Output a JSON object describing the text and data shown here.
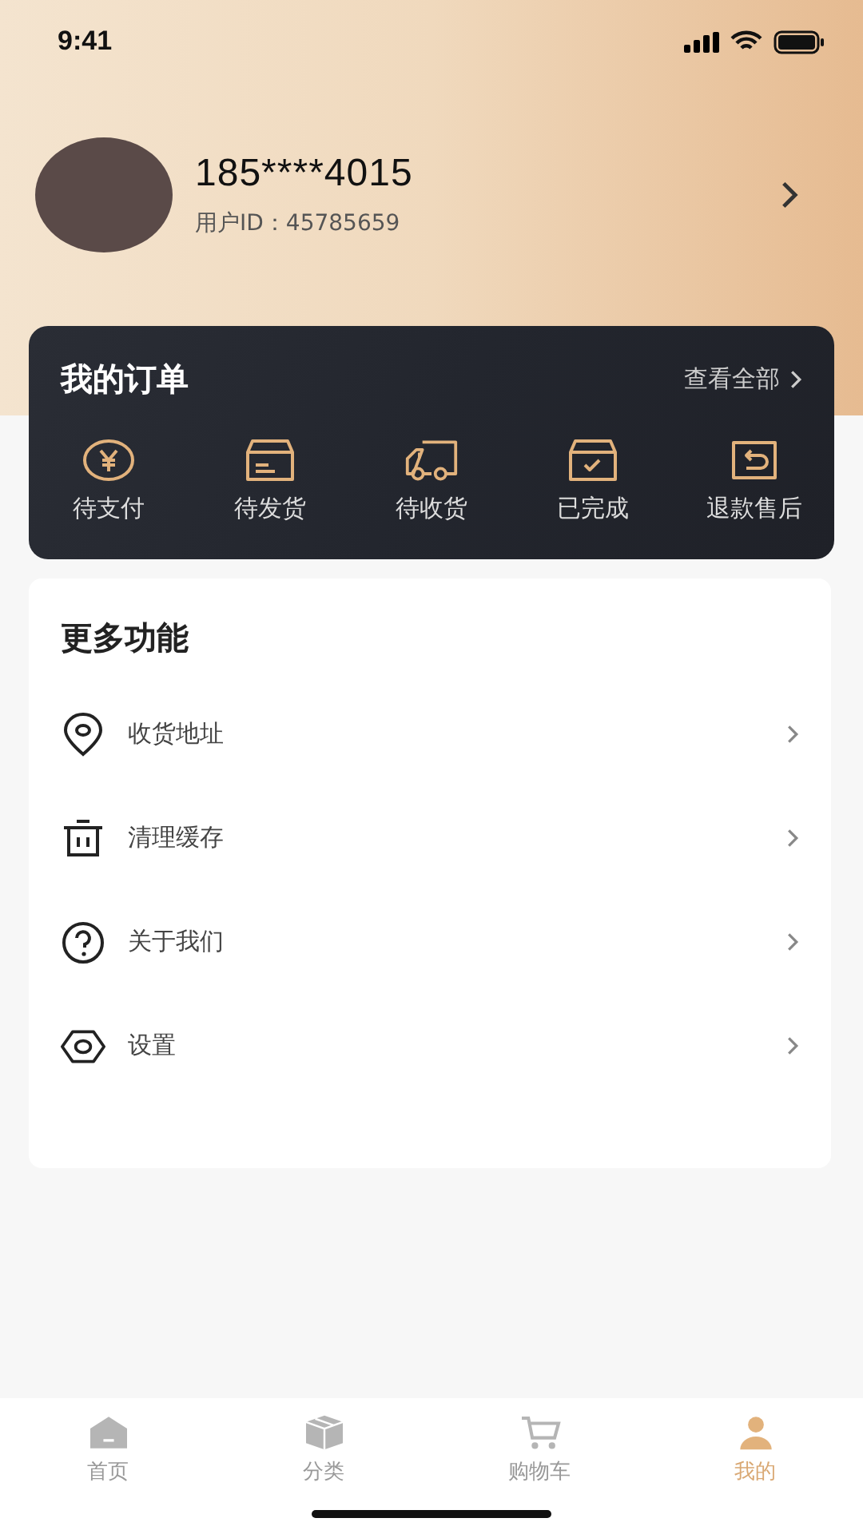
{
  "status_bar": {
    "time": "9:41"
  },
  "profile": {
    "phone": "185****4015",
    "user_id": "用户ID：45785659"
  },
  "orders": {
    "title": "我的订单",
    "view_all": "查看全部",
    "items": [
      {
        "kind": "payment",
        "label": "待支付"
      },
      {
        "kind": "ship",
        "label": "待发货"
      },
      {
        "kind": "truck",
        "label": "待收货"
      },
      {
        "kind": "done",
        "label": "已完成"
      },
      {
        "kind": "refund",
        "label": "退款售后"
      }
    ]
  },
  "more": {
    "title": "更多功能",
    "items": [
      {
        "kind": "location",
        "label": "收货地址"
      },
      {
        "kind": "trash",
        "label": "清理缓存"
      },
      {
        "kind": "help",
        "label": "关于我们"
      },
      {
        "kind": "settings",
        "label": "设置"
      }
    ]
  },
  "tab_bar": [
    {
      "kind": "home",
      "label": "首页",
      "selected": false
    },
    {
      "kind": "category",
      "label": "分类",
      "selected": false
    },
    {
      "kind": "cart",
      "label": "购物车",
      "selected": false
    },
    {
      "kind": "me",
      "label": "我的",
      "selected": true
    }
  ]
}
